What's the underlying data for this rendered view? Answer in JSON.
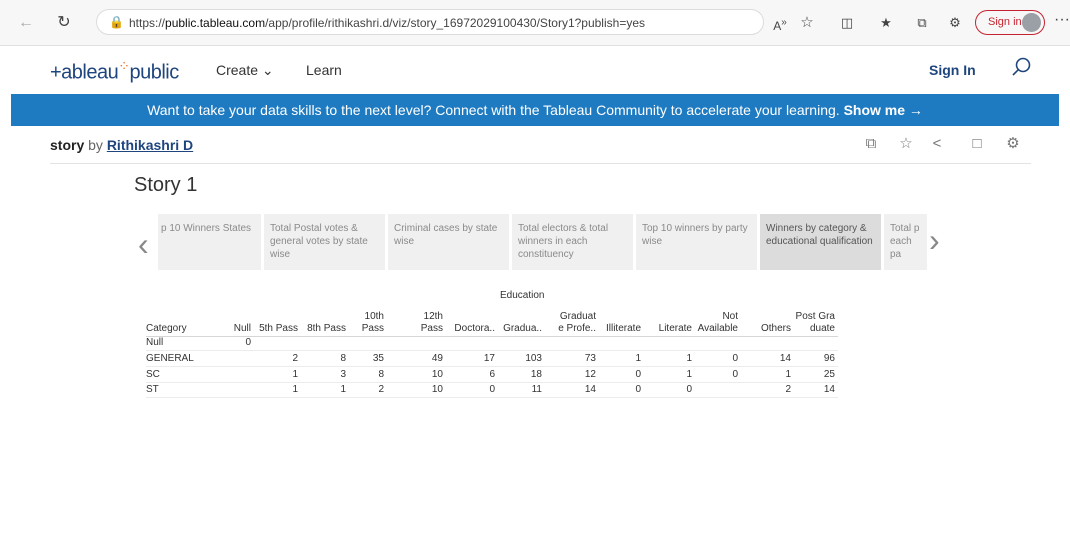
{
  "browser": {
    "url_prefix": "https://",
    "url_domain": "public.tableau.com",
    "url_path": "/app/profile/rithikashri.d/viz/story_16972029100430/Story1?publish=yes",
    "signin_label": "Sign in",
    "more_label": "···"
  },
  "header": {
    "logo_text": "+ableau",
    "logo_text2": "public",
    "create_label": "Create ⌄",
    "learn_label": "Learn",
    "signin_label": "Sign In"
  },
  "banner": {
    "text": "Want to take your data skills to the next level? Connect with the Tableau Community to accelerate your learning.",
    "link": "Show me →"
  },
  "story_bar": {
    "kw": "story",
    "by": "by",
    "author": "Rithikashri D"
  },
  "story": {
    "name": "Story 1",
    "points": [
      "p 10 Winners States",
      "Total Postal votes & general  votes by state wise",
      "Criminal cases by state wise",
      "Total electors & total winners in each constituency",
      "Top 10 winners by party wise",
      "Winners by category & educational qualification",
      "Total p each pa"
    ]
  },
  "table": {
    "col_group": "Education",
    "row_header": "Category",
    "columns": [
      [
        "",
        "Null"
      ],
      [
        "",
        "5th Pass"
      ],
      [
        "",
        "8th Pass"
      ],
      [
        "10th",
        "Pass"
      ],
      [
        "12th",
        "Pass"
      ],
      [
        "",
        "Doctora.."
      ],
      [
        "",
        "Gradua.."
      ],
      [
        "Graduat",
        "e Profe.."
      ],
      [
        "",
        "Illiterate"
      ],
      [
        "",
        "Literate"
      ],
      [
        "Not",
        "Available"
      ],
      [
        "",
        "Others"
      ],
      [
        "Post Gra",
        "duate"
      ]
    ],
    "rows": [
      {
        "category": "Null",
        "values": [
          "0",
          "",
          "",
          "",
          "",
          "",
          "",
          "",
          "",
          "",
          "",
          "",
          ""
        ]
      },
      {
        "category": "GENERAL",
        "values": [
          "",
          "2",
          "8",
          "35",
          "49",
          "17",
          "103",
          "73",
          "1",
          "1",
          "0",
          "14",
          "96"
        ]
      },
      {
        "category": "SC",
        "values": [
          "",
          "1",
          "3",
          "8",
          "10",
          "6",
          "18",
          "12",
          "0",
          "1",
          "0",
          "1",
          "25"
        ]
      },
      {
        "category": "ST",
        "values": [
          "",
          "1",
          "1",
          "2",
          "10",
          "0",
          "11",
          "14",
          "0",
          "0",
          "",
          "2",
          "14"
        ]
      }
    ]
  }
}
